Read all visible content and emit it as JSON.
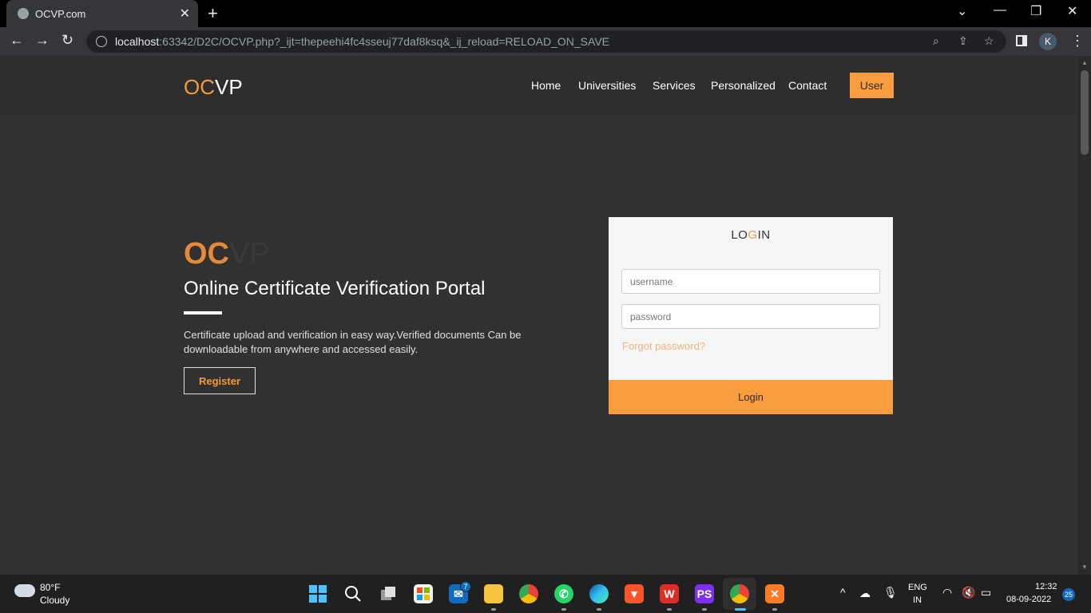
{
  "browser": {
    "tab_title": "OCVP.com",
    "url_host": "localhost",
    "url_rest": ":63342/D2C/OCVP.php?_ijt=thepeehi4fc4sseuj77daf8ksq&_ij_reload=RELOAD_ON_SAVE",
    "profile_initial": "K"
  },
  "site": {
    "brand_oc": "OC",
    "brand_vp": "VP",
    "nav": [
      "Home",
      "Universities",
      "Services",
      "Personalized",
      "Contact"
    ],
    "user_label": "User"
  },
  "hero": {
    "logo_oc": "OC",
    "logo_vp": "VP",
    "title": "Online Certificate Verification Portal",
    "description": "Certificate upload and verification in easy way.Verified documents Can be downloadable from anywhere and accessed easily.",
    "register_label": "Register"
  },
  "login": {
    "title_a": "LO",
    "title_b": "G",
    "title_c": "IN",
    "username_placeholder": "username",
    "password_placeholder": "password",
    "forgot_label": "Forgot password?",
    "submit_label": "Login"
  },
  "taskbar": {
    "temperature": "80°F",
    "condition": "Cloudy",
    "mail_badge": "7",
    "lang_top": "ENG",
    "lang_bottom": "IN",
    "time": "12:32",
    "date": "08-09-2022",
    "notif_count": "25"
  },
  "colors": {
    "accent": "#f99d3f",
    "brand_orange": "#f39a3c",
    "page_bg": "#313131"
  }
}
